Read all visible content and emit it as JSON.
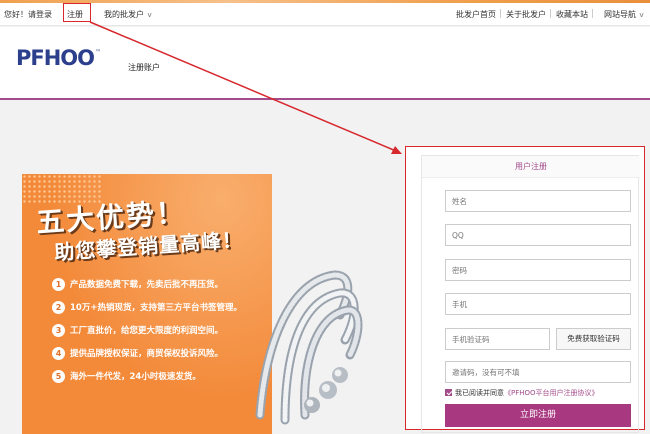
{
  "topbar": {
    "greeting": "您好！请登录",
    "register": "注册",
    "my_wholesale": "我的批发户",
    "home": "批发户首页",
    "about": "关于批发户",
    "favorite": "收藏本站",
    "site_nav": "网站导航"
  },
  "header": {
    "logo_text": "PFHOO",
    "logo_tm": "™",
    "subtitle": "注册账户"
  },
  "banner": {
    "title1": "五大优势！",
    "title2": "助您攀登销量高峰！",
    "items": [
      {
        "num": "1",
        "text": "产品数据免费下载，先卖后批不再压货。"
      },
      {
        "num": "2",
        "text": "10万+热销现货，支持第三方平台书签管理。"
      },
      {
        "num": "3",
        "text": "工厂直批价，给您更大限度的利润空间。"
      },
      {
        "num": "4",
        "text": "提供品牌授权保证，商贸保权投诉风险。"
      },
      {
        "num": "5",
        "text": "海外一件代发，24小时极速发货。"
      }
    ]
  },
  "form": {
    "title": "用户注册",
    "name_placeholder": "姓名",
    "qq_placeholder": "QQ",
    "password_placeholder": "密码",
    "phone_placeholder": "手机",
    "code_placeholder": "手机验证码",
    "code_button": "免费获取验证码",
    "invite_placeholder": "邀请码，没有可不填",
    "agree_text": "我已阅读并同意",
    "agreement_link": "《PFHOO平台用户注册协议》",
    "submit": "立即注册"
  },
  "colors": {
    "brand": "#a34b8b",
    "annotation_red": "#d6282d",
    "banner_orange": "#f38a3a"
  }
}
